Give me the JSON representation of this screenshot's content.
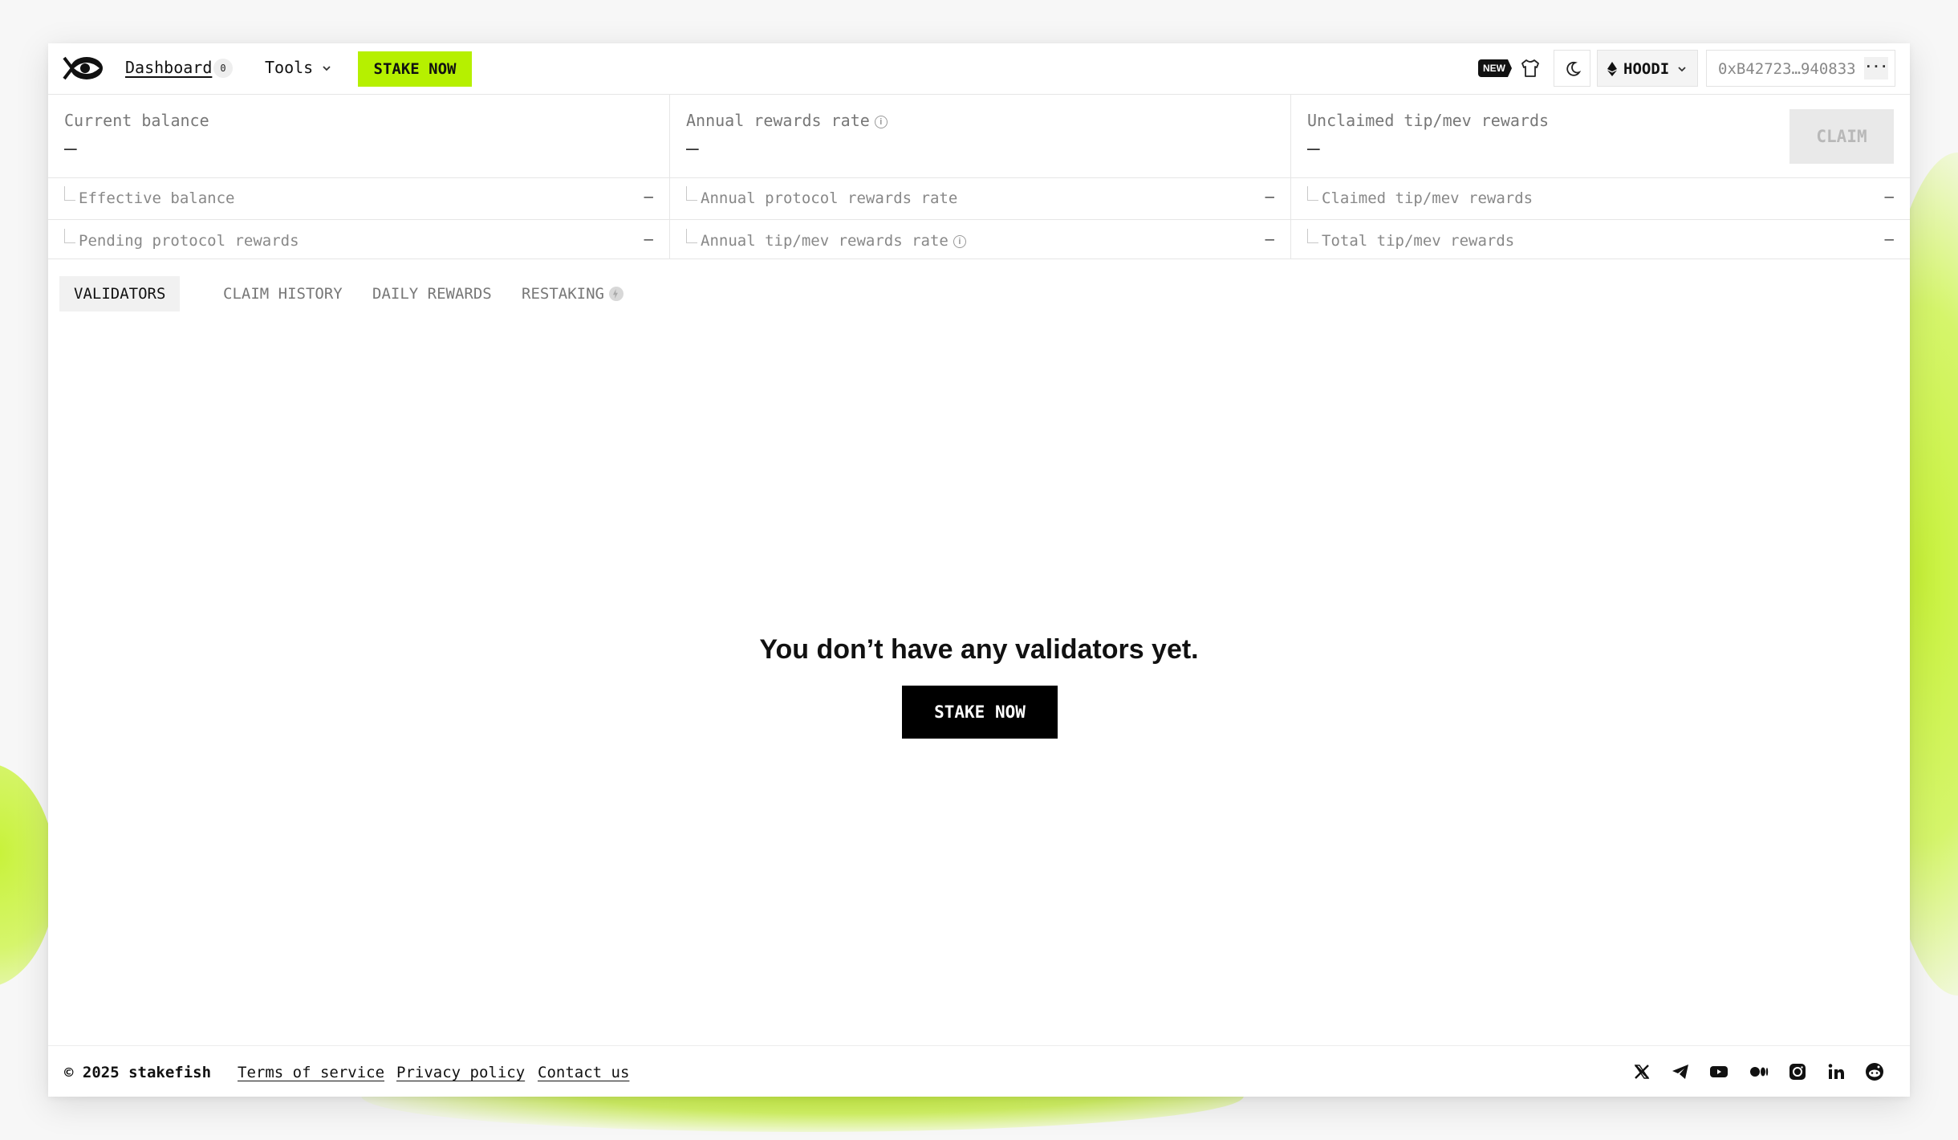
{
  "header": {
    "dashboard_label": "Dashboard",
    "dashboard_count": "0",
    "tools_label": "Tools",
    "stake_label": "STAKE NOW",
    "new_badge": "NEW",
    "network_label": "HOODI",
    "address": "0xB42723…940833",
    "more_label": "···"
  },
  "stats": {
    "col1": {
      "main_label": "Current balance",
      "main_value": "—",
      "sub1_label": "Effective balance",
      "sub1_value": "–",
      "sub2_label": "Pending protocol rewards",
      "sub2_value": "–"
    },
    "col2": {
      "main_label": "Annual rewards rate",
      "main_value": "—",
      "sub1_label": "Annual protocol rewards rate",
      "sub1_value": "–",
      "sub2_label": "Annual tip/mev rewards rate",
      "sub2_value": "–"
    },
    "col3": {
      "main_label": "Unclaimed tip/mev rewards",
      "main_value": "—",
      "claim_label": "CLAIM",
      "sub1_label": "Claimed tip/mev rewards",
      "sub1_value": "–",
      "sub2_label": "Total tip/mev rewards",
      "sub2_value": "–"
    }
  },
  "tabs": [
    {
      "label": "VALIDATORS",
      "active": true
    },
    {
      "label": "CLAIM HISTORY",
      "active": false
    },
    {
      "label": "DAILY REWARDS",
      "active": false
    },
    {
      "label": "RESTAKING",
      "active": false
    }
  ],
  "empty": {
    "title": "You don’t have any validators yet.",
    "button": "STAKE NOW"
  },
  "footer": {
    "copyright": "© 2025 stakefish",
    "links": [
      "Terms of service",
      "Privacy policy",
      "Contact us"
    ],
    "social_icons": [
      "x-icon",
      "telegram-icon",
      "youtube-icon",
      "medium-icon",
      "instagram-icon",
      "linkedin-icon",
      "reddit-icon"
    ]
  },
  "colors": {
    "accent": "#b6f000",
    "primary_button": "#000000",
    "disabled_button": "#e9e9e9"
  }
}
